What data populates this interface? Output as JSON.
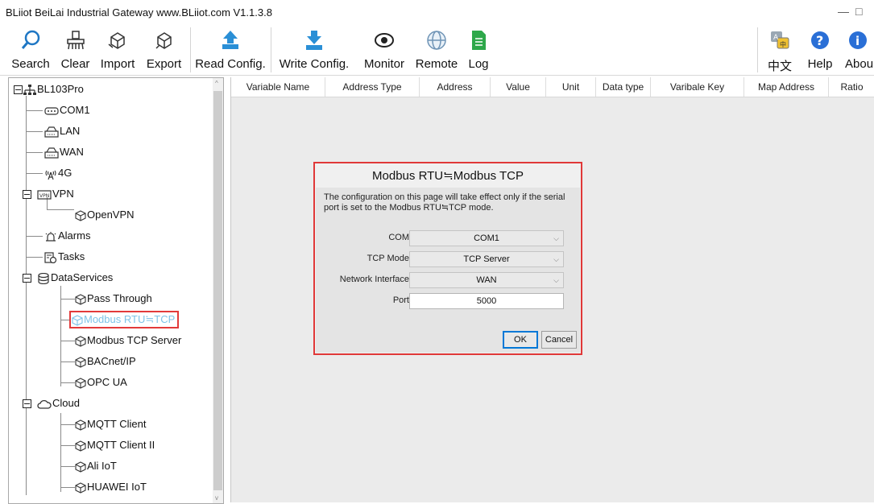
{
  "window": {
    "title": "BLiiot BeiLai Industrial Gateway www.BLiiot.com V1.1.3.8"
  },
  "toolbar": {
    "search": "Search",
    "clear": "Clear",
    "import": "Import",
    "export": "Export",
    "read_config": "Read Config.",
    "write_config": "Write Config.",
    "monitor": "Monitor",
    "remote": "Remote",
    "log": "Log",
    "chinese": "中文",
    "help": "Help",
    "about": "Abou"
  },
  "tree": {
    "root": "BL103Pro",
    "com1": "COM1",
    "lan": "LAN",
    "wan": "WAN",
    "g4": "4G",
    "vpn": "VPN",
    "openvpn": "OpenVPN",
    "alarms": "Alarms",
    "tasks": "Tasks",
    "dataservices": "DataServices",
    "pass_through": "Pass Through",
    "modbus_rtu_tcp": "Modbus RTU≒TCP",
    "modbus_tcp_server": "Modbus TCP Server",
    "bacnet": "BACnet/IP",
    "opcua": "OPC UA",
    "cloud": "Cloud",
    "mqtt": "MQTT Client",
    "mqtt2": "MQTT Client II",
    "ali": "Ali IoT",
    "huawei": "HUAWEI IoT"
  },
  "grid": {
    "columns": [
      "Variable Name",
      "Address Type",
      "Address",
      "Value",
      "Unit",
      "Data type",
      "Varibale Key",
      "Map Address",
      "Ratio"
    ]
  },
  "dialog": {
    "title": "Modbus RTU≒Modbus TCP",
    "message": "The configuration on this page will take effect only if the serial port is set to the Modbus RTU≒TCP mode.",
    "com_label": "COM",
    "com_value": "COM1",
    "tcp_mode_label": "TCP Mode",
    "tcp_mode_value": "TCP Server",
    "netif_label": "Network Interface",
    "netif_value": "WAN",
    "port_label": "Port",
    "port_value": "5000",
    "ok": "OK",
    "cancel": "Cancel"
  },
  "colors": {
    "highlight": "#e23a3a",
    "selected_text": "#7ec3e8",
    "accent": "#2a8fd6"
  }
}
